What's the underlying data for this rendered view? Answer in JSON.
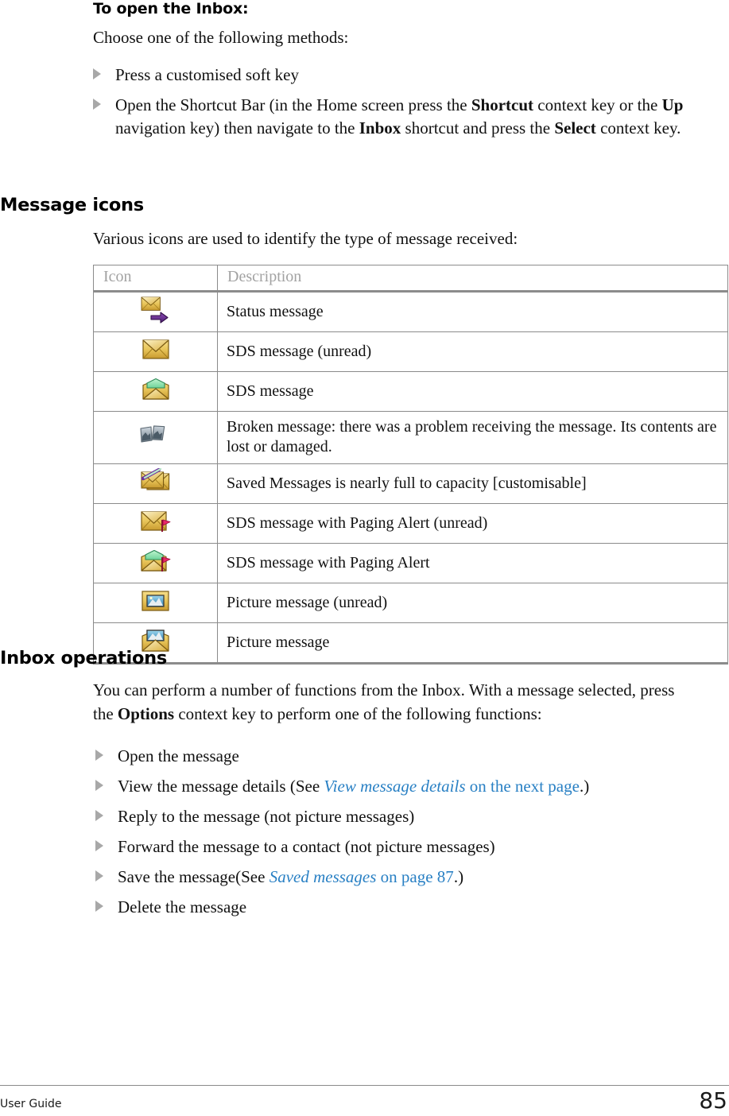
{
  "document": {
    "footer_label": "User Guide",
    "page_number": "85",
    "link_color": "#2980c4",
    "table_header_color": "#a2a2a2"
  },
  "section_open_inbox": {
    "heading": "To open the Inbox:",
    "intro": "Choose one of the following methods:",
    "bullets": [
      {
        "parts": [
          {
            "text": "Press a customised soft key",
            "style": "normal"
          }
        ]
      },
      {
        "parts": [
          {
            "text": "Open the Shortcut Bar (in the Home screen press the ",
            "style": "normal"
          },
          {
            "text": "Shortcut",
            "style": "bold"
          },
          {
            "text": " context key or the ",
            "style": "normal"
          },
          {
            "text": "Up",
            "style": "bold"
          },
          {
            "text": " navigation key) then navigate to the ",
            "style": "normal"
          },
          {
            "text": "Inbox",
            "style": "bold"
          },
          {
            "text": " shortcut and press the ",
            "style": "normal"
          },
          {
            "text": "Select",
            "style": "bold"
          },
          {
            "text": " context key.",
            "style": "normal"
          }
        ]
      }
    ]
  },
  "section_message_icons": {
    "heading": "Message icons",
    "intro": "Various icons are used to identify the type of message received:",
    "table": {
      "columns": [
        "Icon",
        "Description"
      ],
      "rows": [
        {
          "icon": "status-message-icon",
          "description": "Status message"
        },
        {
          "icon": "sds-message-unread-icon",
          "description": "SDS message (unread)"
        },
        {
          "icon": "sds-message-icon",
          "description": "SDS message"
        },
        {
          "icon": "broken-message-icon",
          "description": "Broken message: there was a problem receiving the message. Its contents are lost or damaged."
        },
        {
          "icon": "saved-messages-full-icon",
          "description": "Saved Messages is nearly full to capacity [customisable]"
        },
        {
          "icon": "sds-paging-alert-unread-icon",
          "description": "SDS message with Paging Alert (unread)"
        },
        {
          "icon": "sds-paging-alert-icon",
          "description": "SDS message with Paging Alert"
        },
        {
          "icon": "picture-message-unread-icon",
          "description": "Picture message (unread)"
        },
        {
          "icon": "picture-message-icon",
          "description": "Picture message"
        }
      ]
    }
  },
  "section_inbox_operations": {
    "heading": "Inbox operations",
    "intro_parts": [
      {
        "text": "You can perform a number of functions from the Inbox. With a message selected, press the ",
        "style": "normal"
      },
      {
        "text": "Options",
        "style": "bold"
      },
      {
        "text": " context key to perform one of the following functions:",
        "style": "normal"
      }
    ],
    "bullets": [
      {
        "parts": [
          {
            "text": "Open the message",
            "style": "normal"
          }
        ]
      },
      {
        "parts": [
          {
            "text": "View the message details (See ",
            "style": "normal"
          },
          {
            "text": "View message details",
            "style": "link-italic"
          },
          {
            "text": " on the next page",
            "style": "link"
          },
          {
            "text": ".)",
            "style": "normal"
          }
        ]
      },
      {
        "parts": [
          {
            "text": "Reply to the message (not picture messages)",
            "style": "normal"
          }
        ]
      },
      {
        "parts": [
          {
            "text": "Forward the message to a contact (not picture messages)",
            "style": "normal"
          }
        ]
      },
      {
        "parts": [
          {
            "text": "Save the message(See ",
            "style": "normal"
          },
          {
            "text": "Saved messages",
            "style": "link-italic"
          },
          {
            "text": " on page 87",
            "style": "link"
          },
          {
            "text": ".)",
            "style": "normal"
          }
        ]
      },
      {
        "parts": [
          {
            "text": "Delete the message",
            "style": "normal"
          }
        ]
      }
    ]
  }
}
